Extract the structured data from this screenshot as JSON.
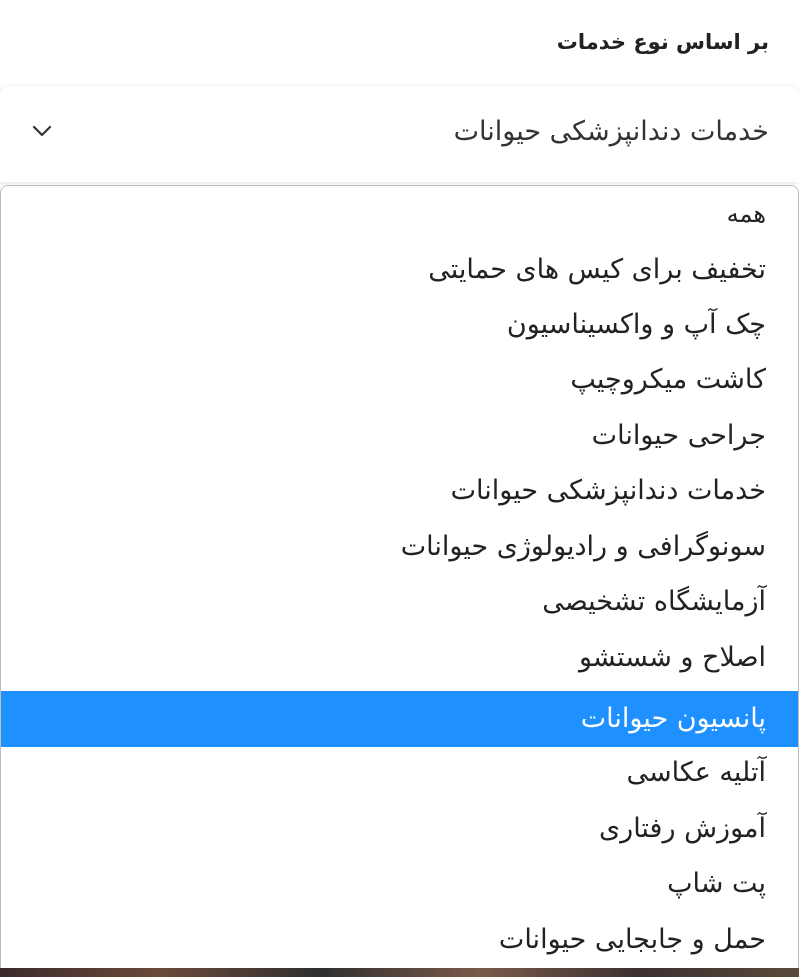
{
  "filter": {
    "label": "بر اساس نوع خدمات",
    "selected_value": "خدمات دندانپزشکی حیوانات",
    "toggle_icon": "chevron-down-icon"
  },
  "dropdown": {
    "highlighted_index": 9,
    "highlight_color": "#1e90ff",
    "options": [
      {
        "label": "همه"
      },
      {
        "label": "تخفیف برای کیس های حمایتی"
      },
      {
        "label": "چک آپ و واکسیناسیون"
      },
      {
        "label": "کاشت میکروچیپ"
      },
      {
        "label": "جراحی حیوانات"
      },
      {
        "label": "خدمات دندانپزشکی حیوانات"
      },
      {
        "label": "سونوگرافی و رادیولوژی حیوانات"
      },
      {
        "label": "آزمایشگاه تشخیصی"
      },
      {
        "label": "اصلاح و شستشو"
      },
      {
        "label": "پانسیون حیوانات"
      },
      {
        "label": "آتلیه عکاسی"
      },
      {
        "label": "آموزش رفتاری"
      },
      {
        "label": "پت شاپ"
      },
      {
        "label": "حمل و جابجایی حیوانات"
      }
    ]
  }
}
